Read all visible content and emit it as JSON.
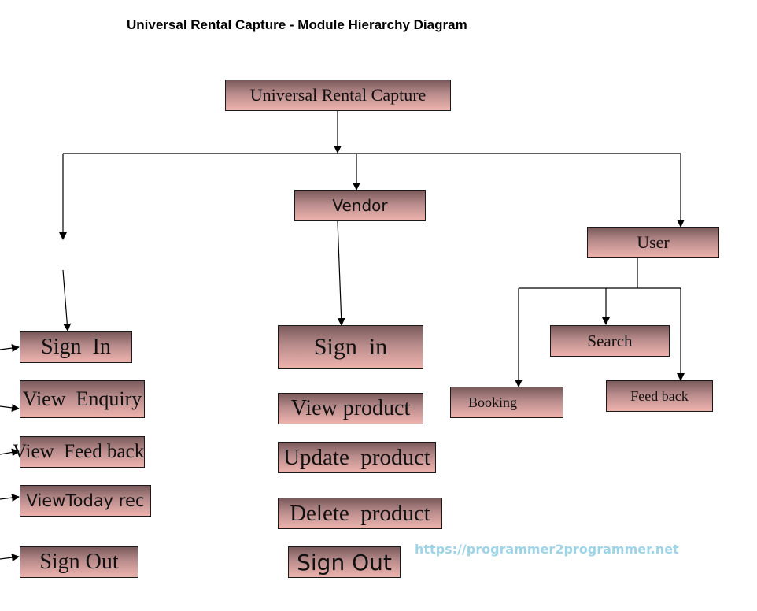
{
  "title": "Universal Rental Capture - Module Hierarchy Diagram",
  "watermark": "https://programmer2programmer.net",
  "colors": {
    "node_top": "#7a5a5c",
    "node_bottom": "#eeb3ad",
    "edge": "#000000",
    "watermark": "#9fd4e6"
  },
  "nodes": {
    "root": "Universal Rental Capture",
    "vendor": "Vendor",
    "user": "User",
    "admin_sign_in": "Sign  In",
    "admin_view_enquiry": "View  Enquiry",
    "admin_view_feedback": "View  Feed back",
    "admin_view_today": "ViewToday rec",
    "admin_sign_out": "Sign Out",
    "vendor_sign_in": "Sign  in",
    "vendor_view_product": "View product",
    "vendor_update_product": "Update  product",
    "vendor_delete_product": "Delete  product",
    "vendor_sign_out": "Sign Out",
    "user_search": "Search",
    "user_booking": "Booking",
    "user_feedback": "Feed back"
  },
  "hierarchy": [
    {
      "parent": "Universal Rental Capture",
      "children": [
        "(unlabeled admin branch)",
        "Vendor",
        "User"
      ]
    },
    {
      "parent": "(unlabeled admin branch)",
      "children": [
        "Sign  In",
        "View  Enquiry",
        "View  Feed back",
        "ViewToday rec",
        "Sign Out"
      ]
    },
    {
      "parent": "Vendor",
      "children": [
        "Sign  in",
        "View product",
        "Update  product",
        "Delete  product",
        "Sign Out"
      ]
    },
    {
      "parent": "User",
      "children": [
        "Booking",
        "Search",
        "Feed back"
      ]
    }
  ]
}
